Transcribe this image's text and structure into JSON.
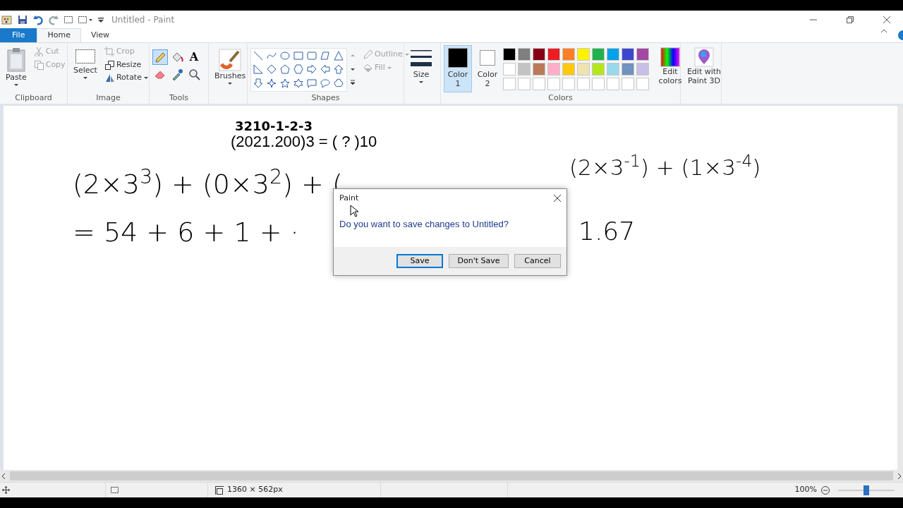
{
  "window": {
    "title": "Untitled - Paint"
  },
  "tabs": [
    {
      "label": "File",
      "kind": "file",
      "selected": false
    },
    {
      "label": "Home",
      "kind": "tab",
      "selected": true
    },
    {
      "label": "View",
      "kind": "tab",
      "selected": false
    }
  ],
  "clipboard": {
    "label": "Clipboard",
    "paste": "Paste",
    "items": [
      {
        "label": "Cut",
        "kind": "cut",
        "disabled": true
      },
      {
        "label": "Copy",
        "kind": "copy",
        "disabled": true
      }
    ]
  },
  "image": {
    "label": "Image",
    "select": "Select",
    "items": [
      {
        "label": "Crop",
        "kind": "crop",
        "disabled": true
      },
      {
        "label": "Resize",
        "kind": "resize",
        "disabled": false
      },
      {
        "label": "Rotate",
        "kind": "rotate",
        "disabled": false
      }
    ]
  },
  "tools": {
    "label": "Tools",
    "items": [
      {
        "kind": "pencil",
        "selected": true
      },
      {
        "kind": "fill",
        "selected": false
      },
      {
        "kind": "text",
        "glyph": "A",
        "selected": false
      },
      {
        "kind": "eraser",
        "selected": false
      },
      {
        "kind": "picker",
        "selected": false
      },
      {
        "kind": "magnifier",
        "selected": false
      }
    ]
  },
  "brushes": {
    "label": "Brushes"
  },
  "shapes": {
    "label": "Shapes",
    "outline": {
      "label": "Outline",
      "disabled": true
    },
    "fill": {
      "label": "Fill",
      "disabled": true
    }
  },
  "size": {
    "label": "Size"
  },
  "colors": {
    "label": "Colors",
    "slots": [
      {
        "label": "Color 1",
        "color": "#000000",
        "selected": true
      },
      {
        "label": "Color 2",
        "color": "#ffffff",
        "selected": false
      }
    ],
    "palette": [
      {
        "color": "#000000"
      },
      {
        "color": "#7f7f7f"
      },
      {
        "color": "#880015"
      },
      {
        "color": "#ed1c24"
      },
      {
        "color": "#ff7f27"
      },
      {
        "color": "#fff200"
      },
      {
        "color": "#22b14c"
      },
      {
        "color": "#00a2e8"
      },
      {
        "color": "#3f48cc"
      },
      {
        "color": "#a349a4"
      },
      {
        "color": "#ffffff"
      },
      {
        "color": "#c3c3c3"
      },
      {
        "color": "#b97a57"
      },
      {
        "color": "#ffaec9"
      },
      {
        "color": "#ffc90e"
      },
      {
        "color": "#efe4b0"
      },
      {
        "color": "#b5e61d"
      },
      {
        "color": "#99d9ea"
      },
      {
        "color": "#7092be"
      },
      {
        "color": "#c8bfe7"
      },
      {
        "kind": "empty"
      },
      {
        "kind": "empty"
      },
      {
        "kind": "empty"
      },
      {
        "kind": "empty"
      },
      {
        "kind": "empty"
      },
      {
        "kind": "empty"
      },
      {
        "kind": "empty"
      },
      {
        "kind": "empty"
      },
      {
        "kind": "empty"
      },
      {
        "kind": "empty"
      }
    ],
    "edit_colors": "Edit colors"
  },
  "paint3d": {
    "label": "Edit with Paint 3D"
  },
  "canvas": {
    "items": [
      {
        "kind": "handwriting",
        "text": "3210-1-2-3"
      },
      {
        "kind": "typed",
        "text": "(2021.200)3 = ( ? )10"
      },
      {
        "kind": "handwriting",
        "text": "(2×3$^{3}$) + (0×3$^{2}$) + ("
      },
      {
        "kind": "handwriting",
        "text": "(2×3$^{-1}$) + (1×3$^{-4}$)"
      },
      {
        "kind": "handwriting",
        "text": "= 54 + 6 + 1 + ·"
      },
      {
        "kind": "handwriting",
        "text": "1.67"
      }
    ]
  },
  "dialog": {
    "title": "Paint",
    "message": "Do you want to save changes to Untitled?",
    "buttons": [
      {
        "label": "Save",
        "selected": true
      },
      {
        "label": "Don't Save",
        "selected": false
      },
      {
        "label": "Cancel",
        "selected": false
      }
    ]
  },
  "status_bar": {
    "dimensions": "1360 × 562px",
    "zoom": "100%",
    "zoom_slider": {
      "level": 0.5
    }
  }
}
